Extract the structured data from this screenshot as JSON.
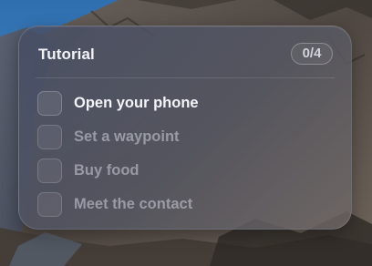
{
  "tutorial": {
    "title": "Tutorial",
    "progress": "0/4",
    "tasks": [
      {
        "label": "Open your phone",
        "state": "active"
      },
      {
        "label": "Set a waypoint",
        "state": "pending"
      },
      {
        "label": "Buy food",
        "state": "pending"
      },
      {
        "label": "Meet the contact",
        "state": "pending"
      }
    ]
  },
  "colors": {
    "sky": "#3c78b4",
    "mountain": "#5a5048",
    "panel_tint": "#4a5066",
    "title_text": "#f2f3f7",
    "inactive_text": "#a9abb6"
  }
}
